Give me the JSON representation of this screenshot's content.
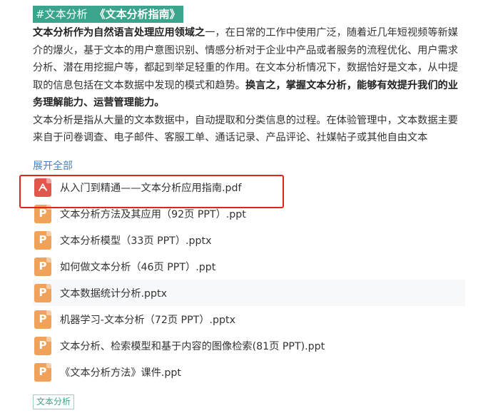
{
  "header": {
    "tag": "#文本分析",
    "book_title": "《文本分析指南》"
  },
  "article": {
    "p1": {
      "s1_bold": "文本分析作为自然语言处理应用领域之",
      "s2": "一，在日常的工作中使用广泛，随着近几年短视频等新媒介的爆火，基于文本的用户意图识别、情感分析对于企业中产品或者服务的流程优化、用户需求分析、潜在用挖掘户等，都起到举足轻重的作用。在文本分析情况下，数据恰好是文本，从中提取的信息包括在文本数据中发现的模式和趋势。",
      "s3_bold": "换言之，掌握文本分析，能够有效提升我们的业务理解能力、运营管理能力。"
    },
    "p2": "文本分析是指从大量的文本数据中，自动提取和分类信息的过程。在体验管理中，文本数据主要来自于问卷调查、电子邮件、客服工单、通话记录、产品评论、社媒帖子或其他自由文本"
  },
  "expand_label": "展开全部",
  "files": [
    {
      "name": "从入门到精通——文本分析应用指南.pdf",
      "type": "pdf"
    },
    {
      "name": "文本分析方法及其应用（92页 PPT）.ppt",
      "type": "ppt"
    },
    {
      "name": "文本分析模型（33页 PPT）.pptx",
      "type": "ppt"
    },
    {
      "name": "如何做文本分析（46页 PPT）.ppt",
      "type": "ppt"
    },
    {
      "name": "文本数据统计分析.pptx",
      "type": "ppt"
    },
    {
      "name": "机器学习-文本分析（72页 PPT）.pptx",
      "type": "ppt"
    },
    {
      "name": "文本分析、检索模型和基于内容的图像检索(81页 PPT).ppt",
      "type": "ppt"
    },
    {
      "name": "《文本分析方法》课件.ppt",
      "type": "ppt"
    }
  ],
  "icons": {
    "pdf": "pdf-file-icon",
    "ppt": "ppt-file-icon",
    "ppt_letter": "P"
  },
  "colors": {
    "accent": "#3aa58c",
    "pdf": "#e2574c",
    "ppt": "#f0a15a",
    "highlight": "#e0241c",
    "link": "#4a7fc0"
  },
  "tags": [
    "文本分析"
  ]
}
